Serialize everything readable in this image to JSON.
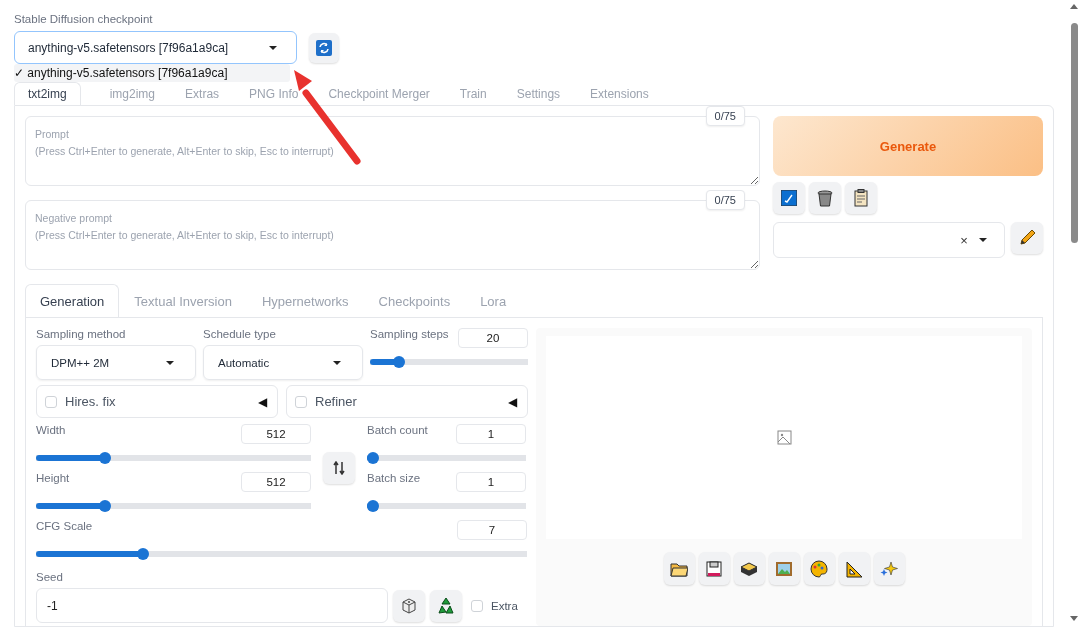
{
  "checkpoint": {
    "label": "Stable Diffusion checkpoint",
    "value": "anything-v5.safetensors [7f96a1a9ca]",
    "options": [
      {
        "check": "✓",
        "label": "anything-v5.safetensors [7f96a1a9ca]",
        "selected": true
      }
    ]
  },
  "tabs": [
    {
      "label": "txt2img",
      "selected": true
    },
    {
      "label": "img2img",
      "selected": false
    },
    {
      "label": "Extras",
      "selected": false
    },
    {
      "label": "PNG Info",
      "selected": false
    },
    {
      "label": "Checkpoint Merger",
      "selected": false
    },
    {
      "label": "Train",
      "selected": false
    },
    {
      "label": "Settings",
      "selected": false
    },
    {
      "label": "Extensions",
      "selected": false
    }
  ],
  "prompt": {
    "placeholder": "Prompt\n(Press Ctrl+Enter to generate, Alt+Enter to skip, Esc to interrupt)",
    "counter": "0/75"
  },
  "negative_prompt": {
    "placeholder": "Negative prompt\n(Press Ctrl+Enter to generate, Alt+Enter to skip, Esc to interrupt)",
    "counter": "0/75"
  },
  "generate_button": "Generate",
  "style_field": {
    "clear": "×"
  },
  "sub_tabs": [
    {
      "label": "Generation",
      "selected": true
    },
    {
      "label": "Textual Inversion",
      "selected": false
    },
    {
      "label": "Hypernetworks",
      "selected": false
    },
    {
      "label": "Checkpoints",
      "selected": false
    },
    {
      "label": "Lora",
      "selected": false
    }
  ],
  "sampling_method": {
    "label": "Sampling method",
    "value": "DPM++ 2M"
  },
  "schedule_type": {
    "label": "Schedule type",
    "value": "Automatic"
  },
  "sampling_steps": {
    "label": "Sampling steps",
    "value": "20",
    "level": 0.16
  },
  "accordions": [
    {
      "label": "Hires. fix",
      "checked": false,
      "toggle": "◀"
    },
    {
      "label": "Refiner",
      "checked": false,
      "toggle": "◀"
    }
  ],
  "width": {
    "label": "Width",
    "value": "512",
    "level": 0.24
  },
  "height": {
    "label": "Height",
    "value": "512",
    "level": 0.24
  },
  "batch_count": {
    "label": "Batch count",
    "value": "1",
    "level": 0
  },
  "batch_size": {
    "label": "Batch size",
    "value": "1",
    "level": 0
  },
  "cfg_scale": {
    "label": "CFG Scale",
    "value": "7",
    "level": 0.21
  },
  "seed": {
    "label": "Seed",
    "value": "-1"
  },
  "extra": {
    "label": "Extra",
    "checked": false
  }
}
